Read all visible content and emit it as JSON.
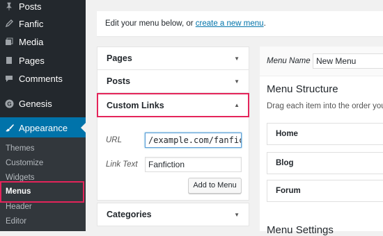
{
  "sidebar": {
    "items": [
      {
        "label": "Posts",
        "icon": "pushpin-icon"
      },
      {
        "label": "Fanfic",
        "icon": "pencil-icon"
      },
      {
        "label": "Media",
        "icon": "media-icon"
      },
      {
        "label": "Pages",
        "icon": "pages-icon"
      },
      {
        "label": "Comments",
        "icon": "comment-icon"
      },
      {
        "label": "Genesis",
        "icon": "genesis-icon"
      },
      {
        "label": "Appearance",
        "icon": "paintbrush-icon"
      }
    ],
    "submenu": [
      "Themes",
      "Customize",
      "Widgets",
      "Menus",
      "Header",
      "Editor"
    ]
  },
  "notice": {
    "text": "Edit your menu below, or ",
    "link": "create a new menu",
    "suffix": "."
  },
  "left_panel": {
    "pages": "Pages",
    "posts": "Posts",
    "custom_links": "Custom Links",
    "url_label": "URL",
    "url_value": "/example.com/fanfic/",
    "link_text_label": "Link Text",
    "link_text_value": "Fanfiction",
    "add_button": "Add to Menu",
    "categories": "Categories"
  },
  "right_panel": {
    "menu_name_label": "Menu Name",
    "menu_name_value": "New Menu",
    "structure_title": "Menu Structure",
    "structure_desc": "Drag each item into the order you p",
    "items": [
      "Home",
      "Blog",
      "Forum"
    ],
    "settings_title": "Menu Settings"
  },
  "colors": {
    "sidebar_bg": "#23282d",
    "accent": "#0073aa",
    "highlight": "#e4245a"
  }
}
